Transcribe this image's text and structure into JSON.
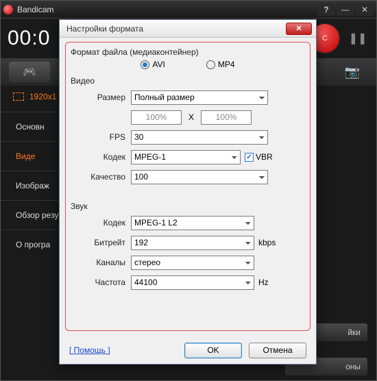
{
  "titlebar": {
    "app_name": "Bandicam"
  },
  "timer": "00:0",
  "rec_label": "C",
  "selection_label": "1920x1",
  "side": {
    "items": [
      "Основн",
      "Виде",
      "Изображ",
      "Обзор резу",
      "О програ"
    ]
  },
  "hidden_button_tail": "йки",
  "hidden_button_tail2": "оны",
  "dialog": {
    "title": "Настройки формата",
    "help": "Помощь",
    "ok": "OK",
    "cancel": "Отмена",
    "format": {
      "group": "Формат файла (медиаконтейнер)",
      "avi": "AVI",
      "mp4": "MP4"
    },
    "video": {
      "group": "Видео",
      "size_label": "Размер",
      "size_value": "Полный размер",
      "pct_w": "100%",
      "pct_h": "100%",
      "x": "X",
      "fps_label": "FPS",
      "fps_value": "30",
      "codec_label": "Кодек",
      "codec_value": "MPEG-1",
      "vbr": "VBR",
      "quality_label": "Качество",
      "quality_value": "100"
    },
    "audio": {
      "group": "Звук",
      "codec_label": "Кодек",
      "codec_value": "MPEG-1 L2",
      "bitrate_label": "Битрейт",
      "bitrate_value": "192",
      "bitrate_unit": "kbps",
      "channels_label": "Каналы",
      "channels_value": "стерео",
      "freq_label": "Частота",
      "freq_value": "44100",
      "freq_unit": "Hz"
    }
  }
}
